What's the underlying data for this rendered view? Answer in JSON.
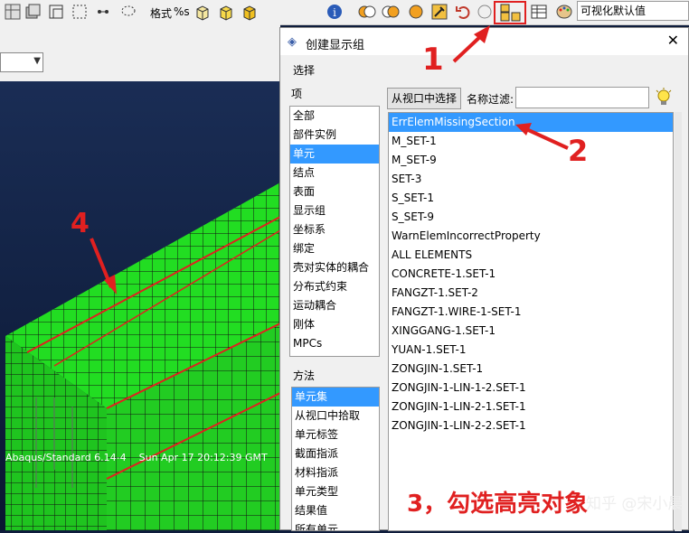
{
  "toolbar": {
    "format_label": "格式",
    "format_value": "%s",
    "visualization_value": "可视化默认值",
    "icons": [
      "grid-icon",
      "box-icon",
      "box-icon",
      "box-icon",
      "box-icon",
      "info-icon",
      "circle-toggle-icon",
      "circle-toggle-icon",
      "sphere-icon",
      "hammer-icon",
      "undo-icon",
      "create-display-group-icon",
      "table-icon",
      "palette-icon"
    ]
  },
  "viewport": {
    "info_text": "Abaqus/Standard 6.14-4    Sun Apr 17 20:12:39 GMT"
  },
  "dialog": {
    "title": "创建显示组",
    "section_select": "选择",
    "items_label": "项",
    "items": [
      "全部",
      "部件实例",
      "单元",
      "结点",
      "表面",
      "显示组",
      "坐标系",
      "绑定",
      "壳对实体的耦合",
      "分布式约束",
      "运动耦合",
      "刚体",
      "MPCs"
    ],
    "items_selected_index": 2,
    "method_label": "方法",
    "methods": [
      "单元集",
      "从视口中拾取",
      "单元标签",
      "截面指派",
      "材料指派",
      "单元类型",
      "结果值",
      "所有单元"
    ],
    "methods_selected_index": 0,
    "pick_from_viewport_button": "从视口中选择",
    "name_filter_label": "名称过滤:",
    "name_filter_value": "",
    "sets": [
      "ErrElemMissingSection",
      "M_SET-1",
      "M_SET-9",
      "SET-3",
      "S_SET-1",
      "S_SET-9",
      "WarnElemIncorrectProperty",
      " ALL ELEMENTS",
      "CONCRETE-1.SET-1",
      "FANGZT-1.SET-2",
      "FANGZT-1.WIRE-1-SET-1",
      "XINGGANG-1.SET-1",
      "YUAN-1.SET-1",
      "ZONGJIN-1.SET-1",
      "ZONGJIN-1-LIN-1-2.SET-1",
      "ZONGJIN-1-LIN-2-1.SET-1",
      "ZONGJIN-1-LIN-2-2.SET-1"
    ],
    "sets_selected_index": 0
  },
  "annotations": {
    "n1": "1",
    "n2": "2",
    "n3": "3，勾选高亮对象",
    "n4": "4",
    "watermark": "知乎 @宋小晨"
  },
  "colors": {
    "mesh_green": "#22dd22",
    "highlight_red": "#e02020",
    "selection_blue": "#3399ff"
  }
}
